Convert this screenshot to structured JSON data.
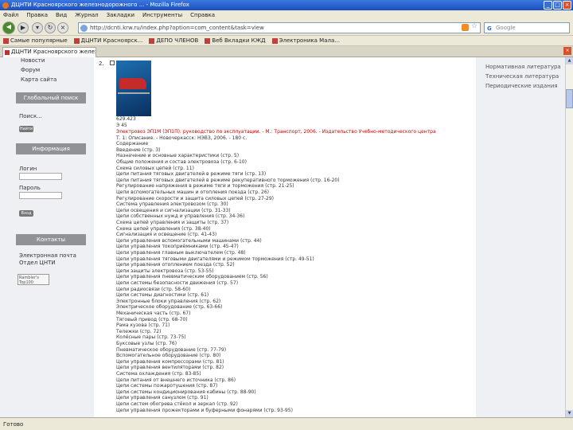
{
  "window": {
    "title": "ДЦНТИ Красноярского железнодорожного ... - Mozilla Firefox"
  },
  "menu": [
    "Файл",
    "Правка",
    "Вид",
    "Журнал",
    "Закладки",
    "Инструменты",
    "Справка"
  ],
  "nav": {
    "url": "http://dcnti.krw.ru/index.php?option=com_content&task=view",
    "search_placeholder": "Google"
  },
  "bookmarks": [
    "Самые популярные",
    "ДЦНТИ Красноярск...",
    "ДЕПО ЧЛЕНОВ",
    "Веб Вкладки КЖД",
    "Электроника Мала..."
  ],
  "tab": {
    "title": "ДЦНТИ Красноярского железнод..."
  },
  "sidebar": {
    "links": [
      "Новости",
      "Форум",
      "Карта сайта"
    ],
    "search_head": "Глобальный поиск",
    "search_label": "Поиск...",
    "search_btn": "Найти",
    "info_head": "Информация",
    "login_label": "Логин",
    "password_label": "Пароль",
    "login_btn": "Вход",
    "contacts_head": "Контакты",
    "contacts": [
      "Электронная почта",
      "Отдел ЦНТИ"
    ],
    "counter": "Rambler's Top100"
  },
  "main": {
    "num": "2.",
    "udc": "629.423",
    "code": "Э 45",
    "lines": [
      "Электровоз ЭП1М (ЭП1П): руководство по эксплуатации. - М.: Транспорт, 2006. - Издательство Учебно-методического центра",
      "Т. 1: Описание. - Новочеркасск: НЭВЗ, 2006. - 180 с.",
      "Содержание",
      "Введение (стр. 3)",
      "Назначение и основные характеристики (стр. 5)",
      "Общие положения и состав электровоза (стр. 6-10)",
      "Схема силовых цепей (стр. 11)",
      "Цепи питания тяговых двигателей в режиме тяги (стр. 13)",
      "Цепи питания тяговых двигателей в режиме рекуперативного торможения (стр. 16-20)",
      "Регулирование напряжения в режиме тяги и торможения (стр. 21-25)",
      "Цепи вспомогательных машин и отопления поезда (стр. 26)",
      "Регулирование скорости и защита силовых цепей (стр. 27-29)",
      "Система управления электровозом (стр. 30)",
      "Цепи освещения и сигнализации (стр. 31-33)",
      "Цепи собственных нужд и управления (стр. 34-36)",
      "Схема цепей управления и защиты (стр. 37)",
      "Схема цепей управления (стр. 38-40)",
      "Сигнализация и освещение (стр. 41-43)",
      "Цепи управления вспомогательными машинами (стр. 44)",
      "Цепи управления токоприёмниками (стр. 45-47)",
      "Цепи управления главным выключателем (стр. 48)",
      "Цепи управления тяговыми двигателями и режимом торможения (стр. 49-51)",
      "Цепи управления отоплением поезда (стр. 52)",
      "Цепи защиты электровоза (стр. 53-55)",
      "Цепи управления пневматическим оборудованием (стр. 56)",
      "Цепи системы безопасности движения (стр. 57)",
      "Цепи радиосвязи (стр. 58-60)",
      "Цепи системы диагностики (стр. 61)",
      "Электронные блоки управления (стр. 62)",
      "Электрическое оборудование (стр. 63-66)",
      "Механическая часть (стр. 67)",
      "Тяговый привод (стр. 68-70)",
      "Рама кузова (стр. 71)",
      "Тележки (стр. 72)",
      "Колёсные пары (стр. 73-75)",
      "Буксовые узлы (стр. 76)",
      "Пневматическое оборудование (стр. 77-79)",
      "Вспомогательное оборудование (стр. 80)",
      "Цепи управления компрессорами (стр. 81)",
      "Цепи управления вентиляторами (стр. 82)",
      "Система охлаждения (стр. 83-85)",
      "Цепи питания от внешнего источника (стр. 86)",
      "Цепи системы пожаротушения (стр. 87)",
      "Цепи системы кондиционирования кабины (стр. 88-90)",
      "Цепи управления санузлом (стр. 91)",
      "Цепи систем обогрева стёкол и зеркал (стр. 92)",
      "Цепи управления прожекторами и буферными фонарями (стр. 93-95)"
    ]
  },
  "rightbar": {
    "links": [
      "Нормативная литература",
      "Техническая литература",
      "Периодические издания"
    ]
  },
  "status": "Готово"
}
